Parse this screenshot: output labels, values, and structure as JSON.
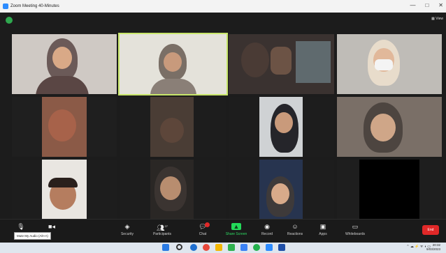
{
  "window": {
    "title": "Zoom Meeting 40-Minutes",
    "minimize": "—",
    "maximize": "□",
    "close": "✕"
  },
  "top_right": {
    "view_label": "▦ View"
  },
  "tooltip": "Mute My Audio (Alt+A)",
  "toolbar": {
    "mute_label": "",
    "video_label": "",
    "security_label": "Security",
    "participants_label": "Participants",
    "participants_count": "27",
    "chat_label": "Chat",
    "share_label": "Share Screen",
    "record_label": "Record",
    "reactions_label": "Reactions",
    "apps_label": "Apps",
    "whiteboards_label": "Whiteboards",
    "end_label": "End"
  },
  "taskbar": {
    "time": "20:32",
    "date": "9/03/2023"
  },
  "icons": [
    "mic-icon",
    "video-icon",
    "shield-icon",
    "participants-icon",
    "chat-icon",
    "share-screen-icon",
    "record-icon",
    "reactions-icon",
    "apps-icon",
    "whiteboard-icon",
    "windows-start-icon",
    "search-icon"
  ],
  "colors": {
    "active_speaker_border": "#c8e66a",
    "share_green": "#23d959",
    "end_red": "#e02828",
    "zoom_blue": "#2d8cff"
  }
}
